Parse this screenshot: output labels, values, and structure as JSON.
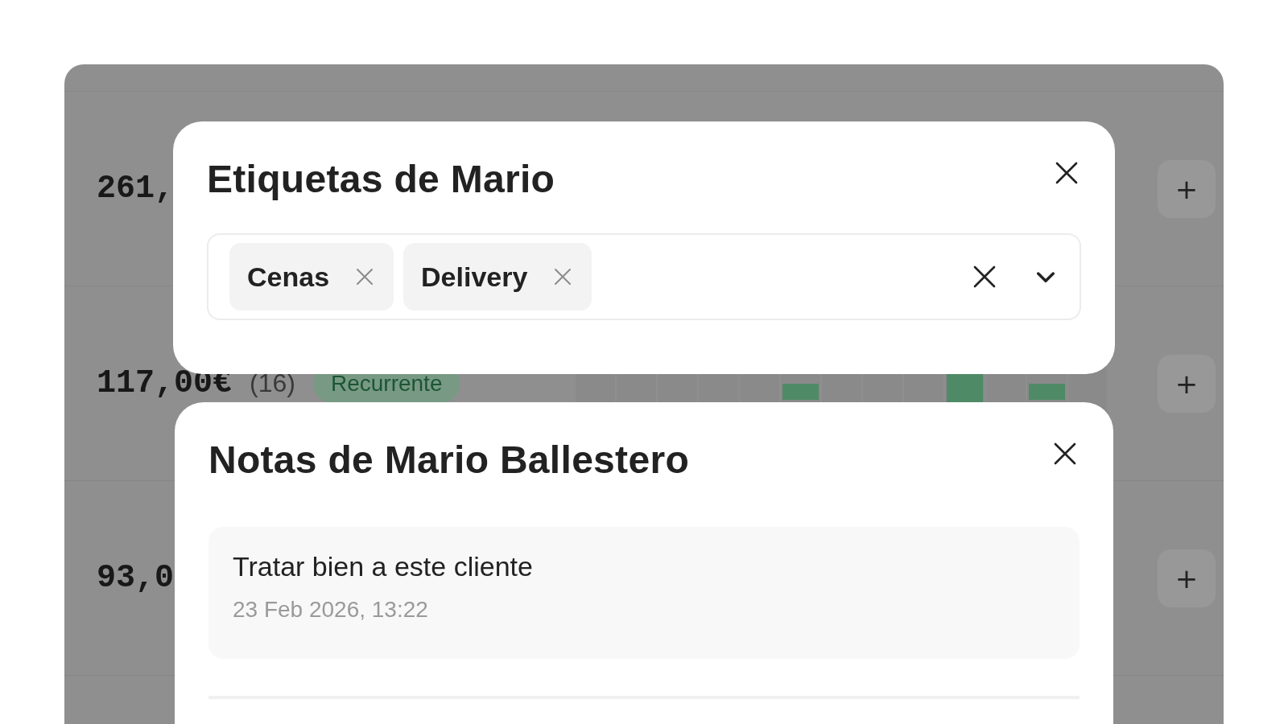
{
  "background_rows": [
    {
      "amount": "261,",
      "add_label": "+"
    },
    {
      "amount": "117,00€",
      "count": "(16)",
      "badge": "Recurrente",
      "add_label": "+"
    },
    {
      "amount": "93,0",
      "add_label": "+"
    }
  ],
  "tags_dialog": {
    "title": "Etiquetas de Mario",
    "tags": [
      {
        "label": "Cenas"
      },
      {
        "label": "Delivery"
      }
    ]
  },
  "notes_dialog": {
    "title": "Notas de Mario Ballestero",
    "notes": [
      {
        "text": "Tratar bien a este cliente",
        "date": "23 Feb 2026, 13:22"
      }
    ]
  }
}
